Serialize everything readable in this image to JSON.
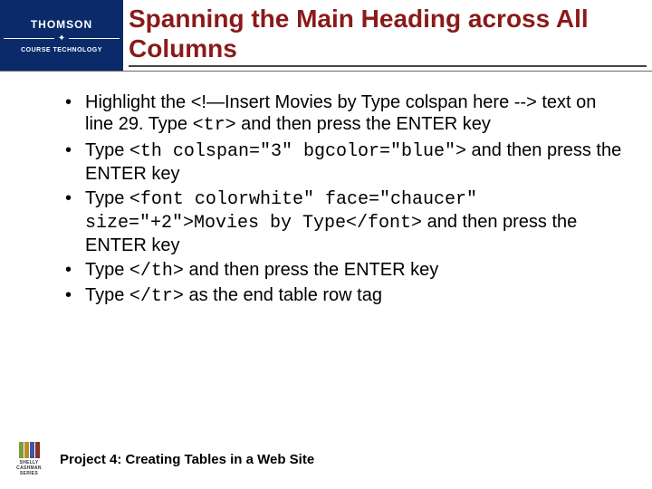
{
  "header": {
    "logo_top": "THOMSON",
    "logo_bottom": "COURSE TECHNOLOGY",
    "title": "Spanning the Main Heading across All Columns"
  },
  "body": {
    "items": [
      {
        "parts": [
          {
            "text": "Highlight the <!—Insert Movies by Type colspan here --> text on line 29. Type ",
            "code": false
          },
          {
            "text": "<tr>",
            "code": true
          },
          {
            "text": " and then press the ENTER key",
            "code": false
          }
        ]
      },
      {
        "parts": [
          {
            "text": "Type ",
            "code": false
          },
          {
            "text": "<th colspan=\"3\" bgcolor=\"blue\">",
            "code": true
          },
          {
            "text": " and then press the ENTER key",
            "code": false
          }
        ]
      },
      {
        "parts": [
          {
            "text": "Type ",
            "code": false
          },
          {
            "text": "<font colorwhite\" face=\"chaucer\" size=\"+2\">Movies by Type</font>",
            "code": true
          },
          {
            "text": " and then press the ENTER key",
            "code": false
          }
        ]
      },
      {
        "parts": [
          {
            "text": "Type ",
            "code": false
          },
          {
            "text": "</th>",
            "code": true
          },
          {
            "text": " and then press the ENTER key",
            "code": false
          }
        ]
      },
      {
        "parts": [
          {
            "text": "Type ",
            "code": false
          },
          {
            "text": "</tr>",
            "code": true
          },
          {
            "text": " as the end table row tag",
            "code": false
          }
        ]
      }
    ]
  },
  "footer": {
    "series_label": "SHELLY CASHMAN SERIES",
    "text": "Project 4: Creating Tables in a Web Site"
  }
}
